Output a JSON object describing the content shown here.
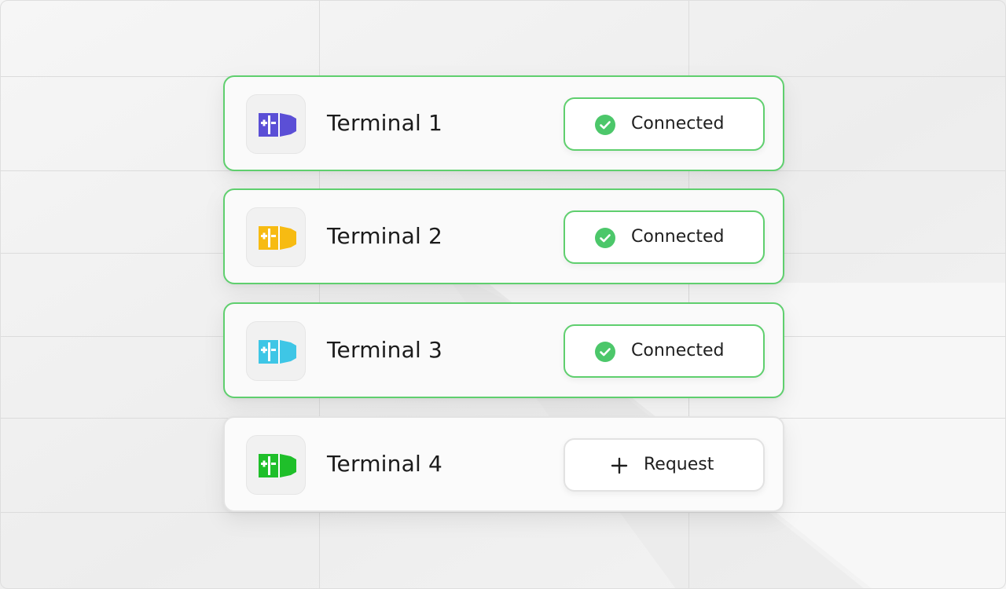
{
  "colors": {
    "connected_accent": "#5fcf6e",
    "check_fill": "#4cc76a",
    "page_background": "#f2f2f2"
  },
  "terminals": [
    {
      "name": "Terminal 1",
      "status": "Connected",
      "icon": "container-icon",
      "icon_color": "#5b4fd6",
      "state": "connected"
    },
    {
      "name": "Terminal 2",
      "status": "Connected",
      "icon": "container-icon",
      "icon_color": "#f7bb12",
      "state": "connected"
    },
    {
      "name": "Terminal 3",
      "status": "Connected",
      "icon": "container-icon",
      "icon_color": "#3ec6e6",
      "state": "connected"
    },
    {
      "name": "Terminal 4",
      "status": "Request",
      "icon": "container-icon",
      "icon_color": "#1fbf2a",
      "state": "request"
    }
  ]
}
